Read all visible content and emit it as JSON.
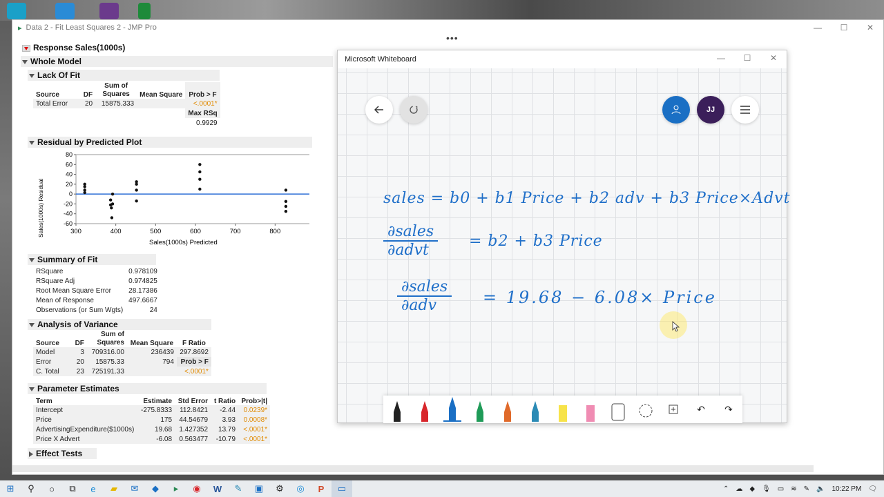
{
  "jmp": {
    "window_title": "Data 2 - Fit Least Squares 2 - JMP Pro",
    "response_title": "Response Sales(1000s)",
    "whole_model": "Whole Model",
    "lack_of_fit": {
      "header": "Lack Of Fit",
      "col_source": "Source",
      "col_df": "DF",
      "col_ss": "Sum of Squares",
      "col_ms": "Mean Square",
      "col_prob": "Prob > F",
      "row_label": "Total Error",
      "row_df": "20",
      "row_ss": "15875.333",
      "row_p": "<.0001*",
      "max_rsq_label": "Max RSq",
      "max_rsq": "0.9929"
    },
    "residual_plot": {
      "header": "Residual by Predicted Plot",
      "ylabel": "Sales(1000s) Residual",
      "xlabel": "Sales(1000s) Predicted"
    },
    "summary_of_fit": {
      "header": "Summary of Fit",
      "rows": [
        {
          "label": "RSquare",
          "value": "0.978109"
        },
        {
          "label": "RSquare Adj",
          "value": "0.974825"
        },
        {
          "label": "Root Mean Square Error",
          "value": "28.17386"
        },
        {
          "label": "Mean of Response",
          "value": "497.6667"
        },
        {
          "label": "Observations (or Sum Wgts)",
          "value": "24"
        }
      ]
    },
    "anova": {
      "header": "Analysis of Variance",
      "cols": [
        "Source",
        "DF",
        "Sum of Squares",
        "Mean Square",
        "F Ratio"
      ],
      "rows": [
        {
          "source": "Model",
          "df": "3",
          "ss": "709316.00",
          "ms": "236439",
          "f": "297.8692"
        },
        {
          "source": "Error",
          "df": "20",
          "ss": "15875.33",
          "ms": "794",
          "f": "Prob > F"
        },
        {
          "source": "C. Total",
          "df": "23",
          "ss": "725191.33",
          "ms": "",
          "f": "<.0001*"
        }
      ]
    },
    "param_est": {
      "header": "Parameter Estimates",
      "cols": [
        "Term",
        "Estimate",
        "Std Error",
        "t Ratio",
        "Prob>|t|"
      ],
      "rows": [
        {
          "term": "Intercept",
          "est": "-275.8333",
          "se": "112.8421",
          "t": "-2.44",
          "p": "0.0239*"
        },
        {
          "term": "Price",
          "est": "175",
          "se": "44.54679",
          "t": "3.93",
          "p": "0.0008*"
        },
        {
          "term": "AdvertisingExpenditure($1000s)",
          "est": "19.68",
          "se": "1.427352",
          "t": "13.79",
          "p": "<.0001*"
        },
        {
          "term": "Price X Advert",
          "est": "-6.08",
          "se": "0.563477",
          "t": "-10.79",
          "p": "<.0001*"
        }
      ]
    },
    "effect_tests": "Effect Tests"
  },
  "chart_data": {
    "type": "scatter",
    "title": "Residual by Predicted Plot",
    "xlabel": "Sales(1000s) Predicted",
    "ylabel": "Sales(1000s) Residual",
    "xlim": [
      300,
      900
    ],
    "ylim": [
      -60,
      80
    ],
    "xticks": [
      "300",
      "400",
      "500",
      "600",
      "700",
      "800",
      "900"
    ],
    "yticks": [
      "80",
      "60",
      "40",
      "20",
      "0",
      "-20",
      "-40",
      "-60"
    ],
    "x": [
      322,
      322,
      322,
      322,
      387,
      387,
      389,
      390,
      392,
      392,
      452,
      452,
      452,
      452,
      611,
      611,
      611,
      611,
      827,
      827,
      827,
      827
    ],
    "y": [
      20,
      15,
      8,
      3,
      -12,
      -22,
      -28,
      -48,
      0,
      -20,
      25,
      20,
      8,
      -14,
      60,
      45,
      30,
      10,
      8,
      -15,
      -25,
      -35
    ]
  },
  "whiteboard": {
    "title": "Microsoft Whiteboard",
    "avatar_initials": "JJ",
    "eq1": "sales = b0 + b1 Price + b2 adv + b3 Price×Advt",
    "eq2_num": "∂sales",
    "eq2_den": "∂advt",
    "eq2_rhs": "= b2 + b3 Price",
    "eq3_num": "∂sales",
    "eq3_den": "∂adv",
    "eq3_rhs": "= 19.68 − 6.08× Price",
    "colors": {
      "ink": "#1f6fc9",
      "accent_blue": "#1a6fc4",
      "avatar": "#3b1f5a"
    }
  },
  "taskbar": {
    "time": "10:22 PM"
  }
}
